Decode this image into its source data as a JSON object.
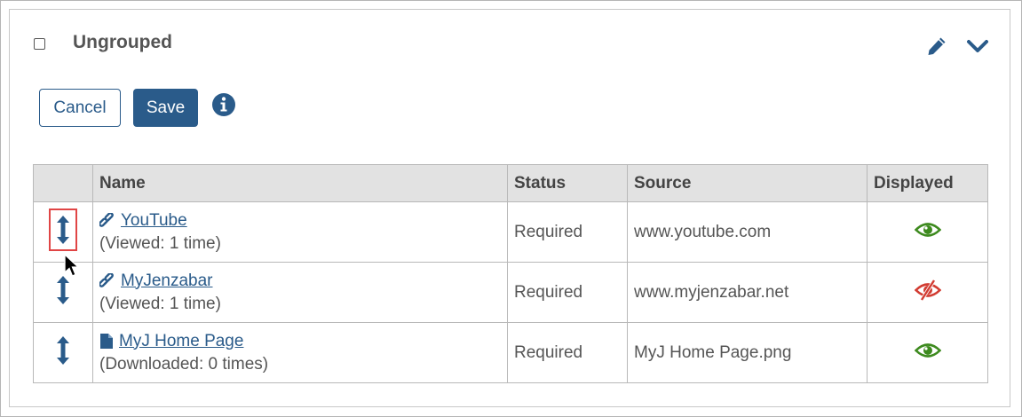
{
  "group": {
    "title": "Ungrouped"
  },
  "icons": {
    "edit": "pencil-icon",
    "collapse": "chevron-down-icon",
    "info": "info-icon",
    "link": "link-icon",
    "file": "file-icon",
    "drag": "updown-arrow-icon",
    "visible": "eye-icon",
    "hidden": "eye-slash-icon"
  },
  "colors": {
    "accent": "#2a5b8a",
    "visible": "#3d8a1e",
    "hidden": "#d23c32",
    "highlight": "#e04545"
  },
  "buttons": {
    "cancel": "Cancel",
    "save": "Save"
  },
  "table": {
    "headers": {
      "name": "Name",
      "status": "Status",
      "source": "Source",
      "displayed": "Displayed"
    },
    "rows": [
      {
        "name": "YouTube",
        "type": "link",
        "sub": "(Viewed: 1 time)",
        "status": "Required",
        "source": "www.youtube.com",
        "displayed": "visible"
      },
      {
        "name": "MyJenzabar",
        "type": "link",
        "sub": "(Viewed: 1 time)",
        "status": "Required",
        "source": "www.myjenzabar.net",
        "displayed": "hidden"
      },
      {
        "name": "MyJ Home Page",
        "type": "file",
        "sub": "(Downloaded: 0 times)",
        "status": "Required",
        "source": "MyJ Home Page.png",
        "displayed": "visible"
      }
    ]
  }
}
